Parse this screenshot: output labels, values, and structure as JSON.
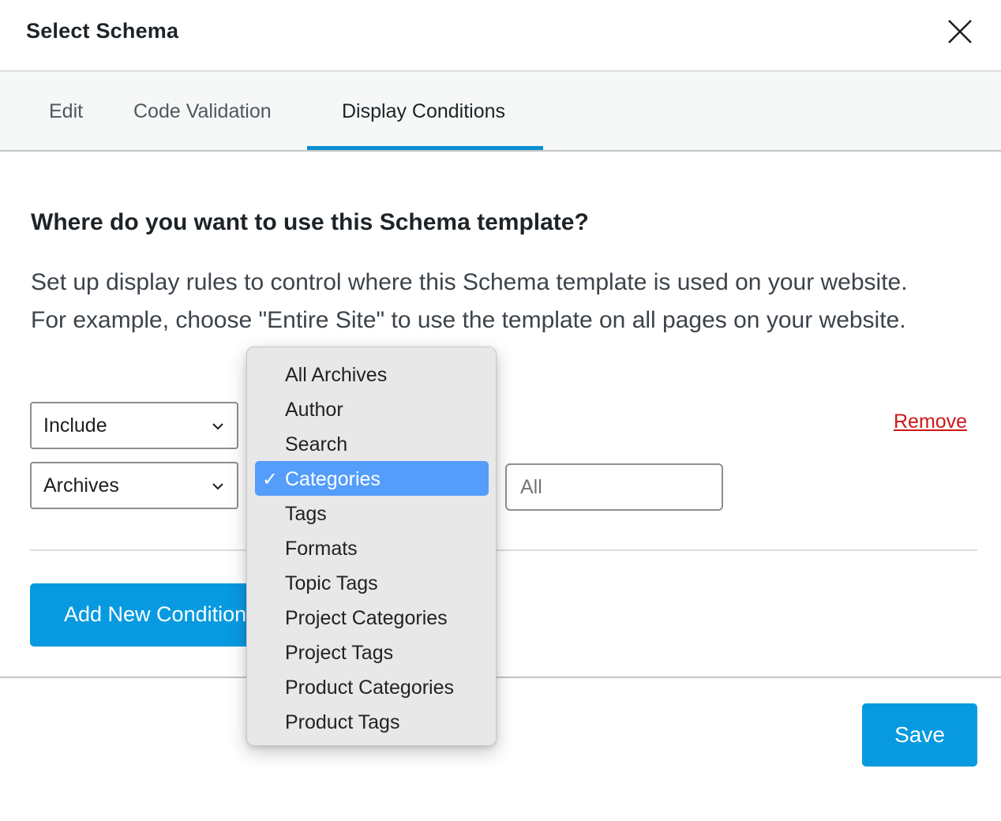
{
  "header": {
    "title": "Select Schema",
    "close_icon": "close-icon"
  },
  "tabs": [
    {
      "label": "Edit",
      "active": false
    },
    {
      "label": "Code Validation",
      "active": false
    },
    {
      "label": "Display Conditions",
      "active": true
    }
  ],
  "content": {
    "question": "Where do you want to use this Schema template?",
    "description": "Set up display rules to control where this Schema template is used on your website. For example, choose \"Entire Site\" to use the template on all pages on your website.",
    "condition": {
      "rule_select_value": "Include",
      "type_select_value": "Archives",
      "target_input_value": "All",
      "remove_label": "Remove"
    },
    "add_condition_label": "Add New Condition"
  },
  "footer": {
    "save_label": "Save"
  },
  "dropdown": {
    "selected_index": 3,
    "check_glyph": "✓",
    "options": [
      "All Archives",
      "Author",
      "Search",
      "Categories",
      "Tags",
      "Formats",
      "Topic Tags",
      "Project Categories",
      "Project Tags",
      "Product Categories",
      "Product Tags"
    ]
  },
  "colors": {
    "accent": "#079ae0",
    "tab_underline": "#0a8fd1",
    "remove": "#cc1818",
    "dropdown_selected": "#549dfa"
  }
}
